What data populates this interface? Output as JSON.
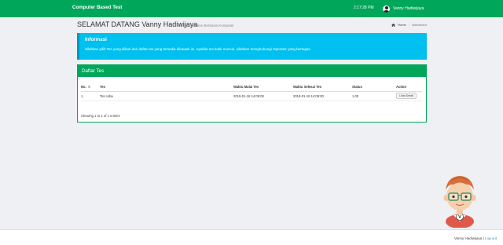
{
  "header": {
    "brand": "Computer Based Test",
    "time": "2:17:28 PM",
    "user_name": "Vanny Hadiwijaya"
  },
  "page": {
    "title": "SELAMAT DATANG Vanny Hadiwijaya",
    "subtitle": "di Ujian Online Berbasis Komputer",
    "breadcrumb": {
      "home": "Home",
      "current": "dashboard"
    }
  },
  "callout": {
    "title": "Informasi",
    "text": "Silahkan pilih Tes yang diikuti dari daftar tes yang tersedia dibawah ini. Apabila tes tidak muncul, silahkan menghubungi Operator yang bertugas."
  },
  "tests": {
    "box_title": "Daftar Tes",
    "columns": [
      "No.",
      "Tes",
      "Waktu Mulai Tes",
      "Waktu Selesai Tes",
      "Status",
      "Action"
    ],
    "rows": [
      {
        "no": "1",
        "name": "Tes coba",
        "start": "2019-01-18 14:09:00",
        "end": "2019-01-19 14:09:00",
        "status": "1.00",
        "action": "Lihat Detail"
      }
    ],
    "info": "Showing 1 to 1 of 1 entries"
  },
  "footer": {
    "name": "Vanny Hadiwijaya",
    "separator": " | ",
    "logout": "Log out"
  },
  "colors": {
    "primary": "#00a65a",
    "callout": "#00c0ef",
    "link": "#3c8dbc"
  },
  "icons": [
    "user-avatar-icon",
    "home-icon",
    "sort-icon"
  ]
}
